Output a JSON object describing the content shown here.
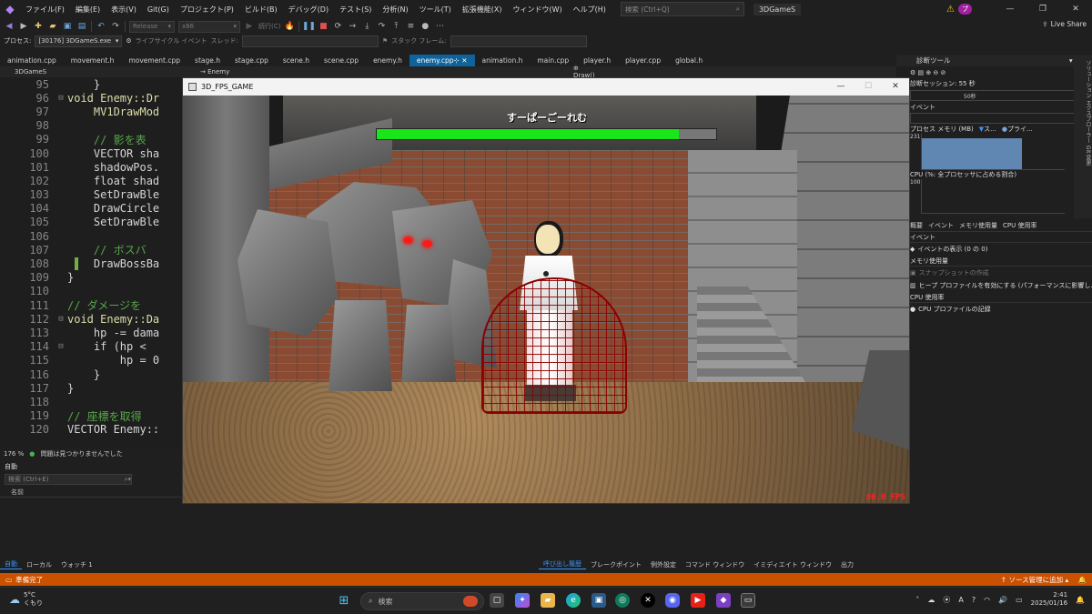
{
  "menubar": {
    "items": [
      "ファイル(F)",
      "編集(E)",
      "表示(V)",
      "Git(G)",
      "プロジェクト(P)",
      "ビルド(B)",
      "デバッグ(D)",
      "テスト(S)",
      "分析(N)",
      "ツール(T)",
      "拡張機能(X)",
      "ウィンドウ(W)",
      "ヘルプ(H)"
    ],
    "search_placeholder": "検索 (Ctrl+Q)",
    "solution_name": "3DGameS",
    "user_badge": "プ",
    "live_share": "Live Share"
  },
  "toolbar": {
    "config": "Release",
    "platform": "x86",
    "continue_label": "続行(C)",
    "process_label": "プロセス:",
    "process_value": "[30176] 3DGameS.exe",
    "lifecycle_label": "ライフサイクル イベント",
    "thread_label": "スレッド:",
    "stackframe_label": "スタック フレーム:"
  },
  "tabs": [
    {
      "label": "animation.cpp",
      "active": false
    },
    {
      "label": "movement.h",
      "active": false
    },
    {
      "label": "movement.cpp",
      "active": false
    },
    {
      "label": "stage.h",
      "active": false
    },
    {
      "label": "stage.cpp",
      "active": false
    },
    {
      "label": "scene.h",
      "active": false
    },
    {
      "label": "scene.cpp",
      "active": false
    },
    {
      "label": "enemy.h",
      "active": false
    },
    {
      "label": "enemy.cpp",
      "active": true
    },
    {
      "label": "animation.h",
      "active": false
    },
    {
      "label": "main.cpp",
      "active": false
    },
    {
      "label": "player.h",
      "active": false
    },
    {
      "label": "player.cpp",
      "active": false
    },
    {
      "label": "global.h",
      "active": false
    }
  ],
  "navbar": {
    "project": "3DGameS",
    "class": "Enemy",
    "member": "Draw()"
  },
  "editor": {
    "lines": [
      {
        "n": "95",
        "code": "    }",
        "cls": "tx"
      },
      {
        "n": "96",
        "code": "void Enemy::Dr",
        "cls": "fn"
      },
      {
        "n": "97",
        "code": "    MV1DrawMod",
        "cls": "fn"
      },
      {
        "n": "98",
        "code": "",
        "cls": "tx"
      },
      {
        "n": "99",
        "code": "    // 影を表",
        "cls": "cm"
      },
      {
        "n": "100",
        "code": "    VECTOR sha",
        "cls": "tx"
      },
      {
        "n": "101",
        "code": "    shadowPos.",
        "cls": "tx"
      },
      {
        "n": "102",
        "code": "    float shad",
        "cls": "tx"
      },
      {
        "n": "103",
        "code": "    SetDrawBle",
        "cls": "tx"
      },
      {
        "n": "104",
        "code": "    DrawCircle",
        "cls": "tx"
      },
      {
        "n": "105",
        "code": "    SetDrawBle",
        "cls": "tx"
      },
      {
        "n": "106",
        "code": "",
        "cls": "tx"
      },
      {
        "n": "107",
        "code": "    // ボスバ",
        "cls": "cm"
      },
      {
        "n": "108",
        "code": "    DrawBossBa",
        "cls": "tx"
      },
      {
        "n": "109",
        "code": "}",
        "cls": "tx"
      },
      {
        "n": "110",
        "code": "",
        "cls": "tx"
      },
      {
        "n": "111",
        "code": "// ダメージを",
        "cls": "cm"
      },
      {
        "n": "112",
        "code": "void Enemy::Da",
        "cls": "fn"
      },
      {
        "n": "113",
        "code": "    hp -= dama",
        "cls": "tx"
      },
      {
        "n": "114",
        "code": "    if (hp < ",
        "cls": "tx"
      },
      {
        "n": "115",
        "code": "        hp = 0",
        "cls": "tx"
      },
      {
        "n": "116",
        "code": "    }",
        "cls": "tx"
      },
      {
        "n": "117",
        "code": "}",
        "cls": "tx"
      },
      {
        "n": "118",
        "code": "",
        "cls": "tx"
      },
      {
        "n": "119",
        "code": "// 座標を取得",
        "cls": "cm"
      },
      {
        "n": "120",
        "code": "VECTOR Enemy::",
        "cls": "tx"
      }
    ],
    "zoom": "176 %",
    "issues": "問題は見つかりませんでした"
  },
  "auto_panel": {
    "title": "自動",
    "search_placeholder": "検索 (Ctrl+E)",
    "column_name": "名前",
    "tabs": [
      "自動",
      "ローカル",
      "ウォッチ 1"
    ]
  },
  "bottom_right_tabs": [
    "呼び出し履歴",
    "ブレークポイント",
    "例外設定",
    "コマンド ウィンドウ",
    "イミディエイト ウィンドウ",
    "出力"
  ],
  "diagnostics": {
    "title": "診断ツール",
    "session": "診断セッション: 55 秒",
    "timeline_mark": "50秒",
    "events_header": "イベント",
    "memory_header": "プロセス メモリ (MB)",
    "memory_legend_a": "ス...",
    "memory_legend_b": "プライ...",
    "mem_max": "231",
    "mem_min": "0",
    "cpu_header": "CPU (%: 全プロセッサに占める割合)",
    "cpu_max": "100",
    "cpu_min": "0",
    "tabs": [
      "概要",
      "イベント",
      "メモリ使用量",
      "CPU 使用率"
    ],
    "events_section": "イベント",
    "events_show": "イベントの表示 (0 の 0)",
    "memory_section": "メモリ使用量",
    "snapshot": "スナップショットの作成",
    "heap_profile": "ヒープ プロファイルを有効にする (パフォーマンスに影響し...",
    "cpu_section": "CPU 使用率",
    "cpu_record": "CPU プロファイルの記録",
    "side_strip": "ソリューション エクスプローラー  Git 変更"
  },
  "game": {
    "window_title": "3D_FPS_GAME",
    "boss_name": "すーぱーごーれむ",
    "boss_hp_fraction": 0.89,
    "hp_fill_color": "#19e619",
    "fps_text": "60.0 FPS"
  },
  "statusbar": {
    "left": "準備完了",
    "right": "ソース管理に追加"
  },
  "taskbar": {
    "temperature": "5°C",
    "weather": "くもり",
    "search_label": "検索",
    "time": "2:41",
    "date": "2025/01/16"
  }
}
